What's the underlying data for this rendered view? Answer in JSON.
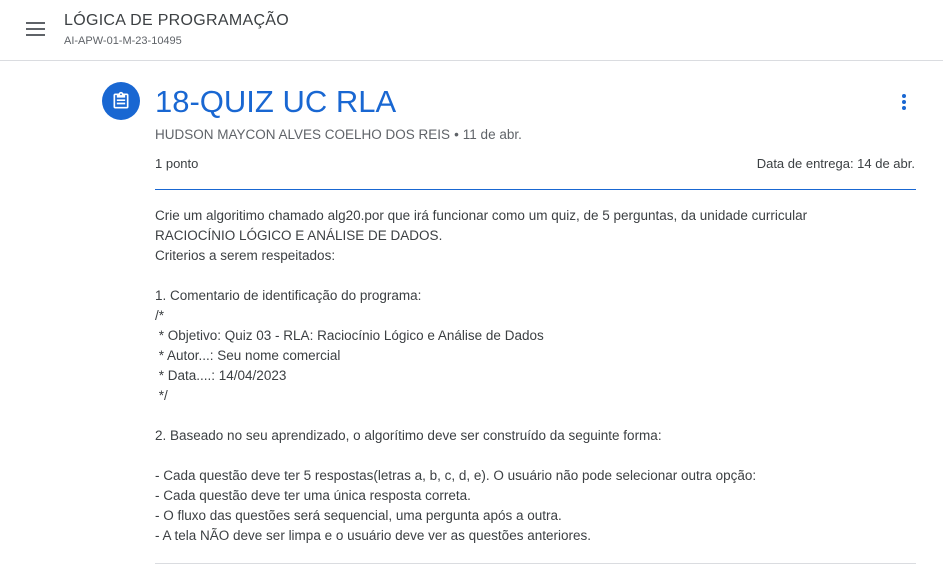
{
  "header": {
    "course_title": "LÓGICA DE PROGRAMAÇÃO",
    "course_code": "AI-APW-01-M-23-10495",
    "menu_icon": "hamburger-menu-icon"
  },
  "assignment": {
    "icon": "assignment-clipboard-icon",
    "title": "18-QUIZ UC RLA",
    "author": "HUDSON MAYCON ALVES COELHO DOS REIS",
    "separator": "•",
    "posted": "11 de abr.",
    "points": "1 ponto",
    "due": "Data de entrega: 14 de abr.",
    "more_icon": "more-vertical-icon",
    "description_lines": [
      "Crie um algoritimo chamado alg20.por que irá funcionar como um quiz, de 5 perguntas, da unidade curricular",
      "RACIOCÍNIO LÓGICO E ANÁLISE DE DADOS.",
      "Criterios a serem respeitados:",
      "",
      "1. Comentario de identificação do programa:",
      "/*",
      " * Objetivo: Quiz 03 - RLA: Raciocínio Lógico e Análise de Dados",
      " * Autor...: Seu nome comercial",
      " * Data....: 14/04/2023",
      " */",
      "",
      "2. Baseado no seu aprendizado, o algorítimo deve ser construído da seguinte forma:",
      "",
      "- Cada questão deve ter 5 respostas(letras a, b, c, d, e). O usuário não pode selecionar outra opção:",
      "- Cada questão deve ter uma única resposta correta.",
      "- O fluxo das questões será sequencial, uma pergunta após a outra.",
      "- A tela NÃO deve ser limpa e o usuário deve ver as questões anteriores."
    ]
  },
  "colors": {
    "accent": "#1967d2",
    "text": "#3c4043",
    "muted": "#5f6368"
  }
}
